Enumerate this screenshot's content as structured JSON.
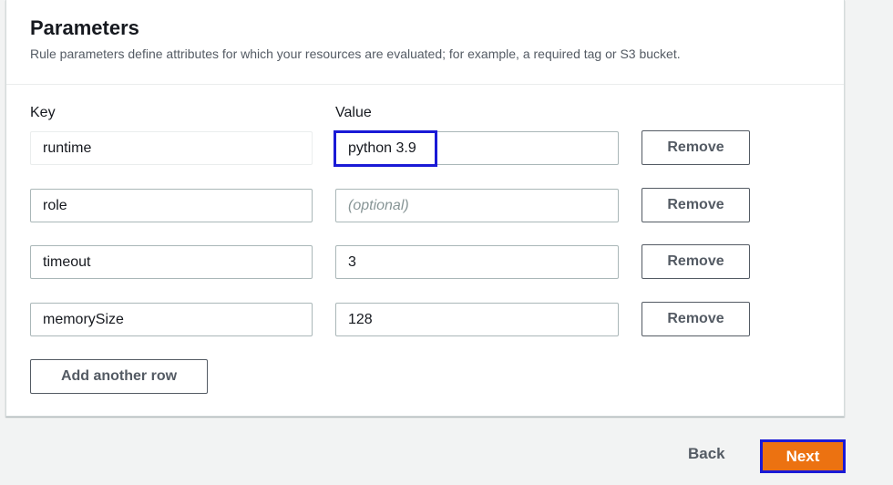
{
  "parameters": {
    "title": "Parameters",
    "description": "Rule parameters define attributes for which your resources are evaluated; for example, a required tag or S3 bucket.",
    "key_label": "Key",
    "value_label": "Value",
    "rows": [
      {
        "key": "runtime",
        "value": "python 3.9",
        "value_placeholder": "",
        "remove_label": "Remove"
      },
      {
        "key": "role",
        "value": "",
        "value_placeholder": "(optional)",
        "remove_label": "Remove"
      },
      {
        "key": "timeout",
        "value": "3",
        "value_placeholder": "",
        "remove_label": "Remove"
      },
      {
        "key": "memorySize",
        "value": "128",
        "value_placeholder": "",
        "remove_label": "Remove"
      }
    ],
    "add_row_label": "Add another row"
  },
  "footer": {
    "back_label": "Back",
    "next_label": "Next"
  },
  "colors": {
    "primary_button": "#ec7211",
    "highlight_outline": "#1a1ad6"
  }
}
